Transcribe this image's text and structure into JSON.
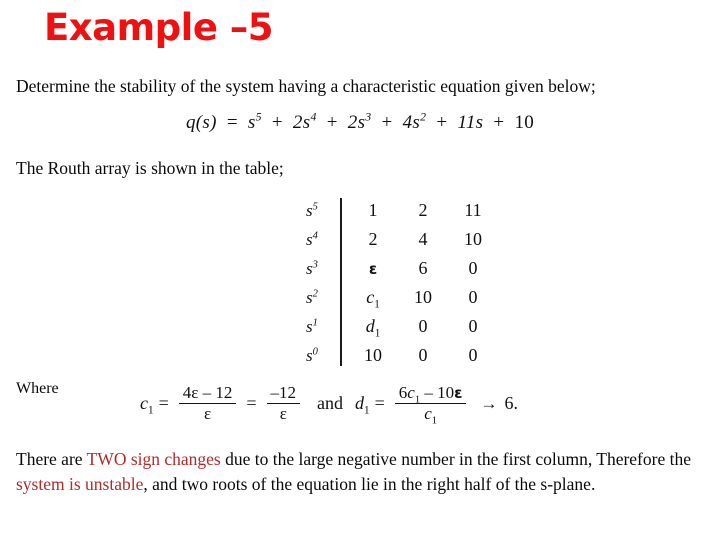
{
  "slide": {
    "title": "Example –5",
    "title_color": "#EE1111",
    "accent_color": "#B02B2B",
    "background_color": "#FFFFFF"
  },
  "intro": {
    "paragraph": "Determine the stability of the system having a characteristic equation given below;"
  },
  "characteristic_equation": {
    "lhs": "q(s)",
    "equals": "=",
    "plain_text": "q(s) = s^5 + 2s^4 + 2s^3 + 4s^2 + 11s + 10",
    "terms": [
      {
        "coefficient": "",
        "variable": "s",
        "exponent": "5"
      },
      {
        "coefficient": "2",
        "variable": "s",
        "exponent": "4"
      },
      {
        "coefficient": "2",
        "variable": "s",
        "exponent": "3"
      },
      {
        "coefficient": "4",
        "variable": "s",
        "exponent": "2"
      },
      {
        "coefficient": "11",
        "variable": "s",
        "exponent": ""
      },
      {
        "coefficient": "10",
        "variable": "",
        "exponent": ""
      }
    ],
    "plus": "+"
  },
  "routh_intro": {
    "text": "The Routh array is shown in the table;"
  },
  "routh_array": {
    "rows": [
      {
        "power_base": "s",
        "power_exp": "5",
        "c1": "1",
        "c2": "2",
        "c3": "11"
      },
      {
        "power_base": "s",
        "power_exp": "4",
        "c1": "2",
        "c2": "4",
        "c3": "10"
      },
      {
        "power_base": "s",
        "power_exp": "3",
        "c1": "ε",
        "c2": "6",
        "c3": "0"
      },
      {
        "power_base": "s",
        "power_exp": "2",
        "c1": "c1",
        "c2": "10",
        "c3": "0"
      },
      {
        "power_base": "s",
        "power_exp": "1",
        "c1": "d1",
        "c2": "0",
        "c3": "0"
      },
      {
        "power_base": "s",
        "power_exp": "0",
        "c1": "10",
        "c2": "0",
        "c3": "0"
      }
    ]
  },
  "where": {
    "label": "Where",
    "c1_symbol": "c",
    "c1_index": "1",
    "d1_symbol": "d",
    "d1_index": "1",
    "equals": "=",
    "and": "and",
    "arrow": "→",
    "c1_num": "4ε – 12",
    "c1_den": "ε",
    "c1_simplified_num": "–12",
    "c1_simplified_den": "ε",
    "d1_num": "6c1 – 10ε",
    "d1_den": "c1",
    "d1_result": "6.",
    "plain_text": "c1 = (4ε – 12)/ε = –12/ε  and  d1 = (6c1 – 10ε)/c1 → 6."
  },
  "conclusion": {
    "part1": "There are ",
    "highlight1": "TWO sign changes",
    "part2": " due to the large negative number in the first column, Therefore the ",
    "highlight2": "system is unstable",
    "part3": ", and two roots of the equation lie in the right half of the s-plane."
  }
}
